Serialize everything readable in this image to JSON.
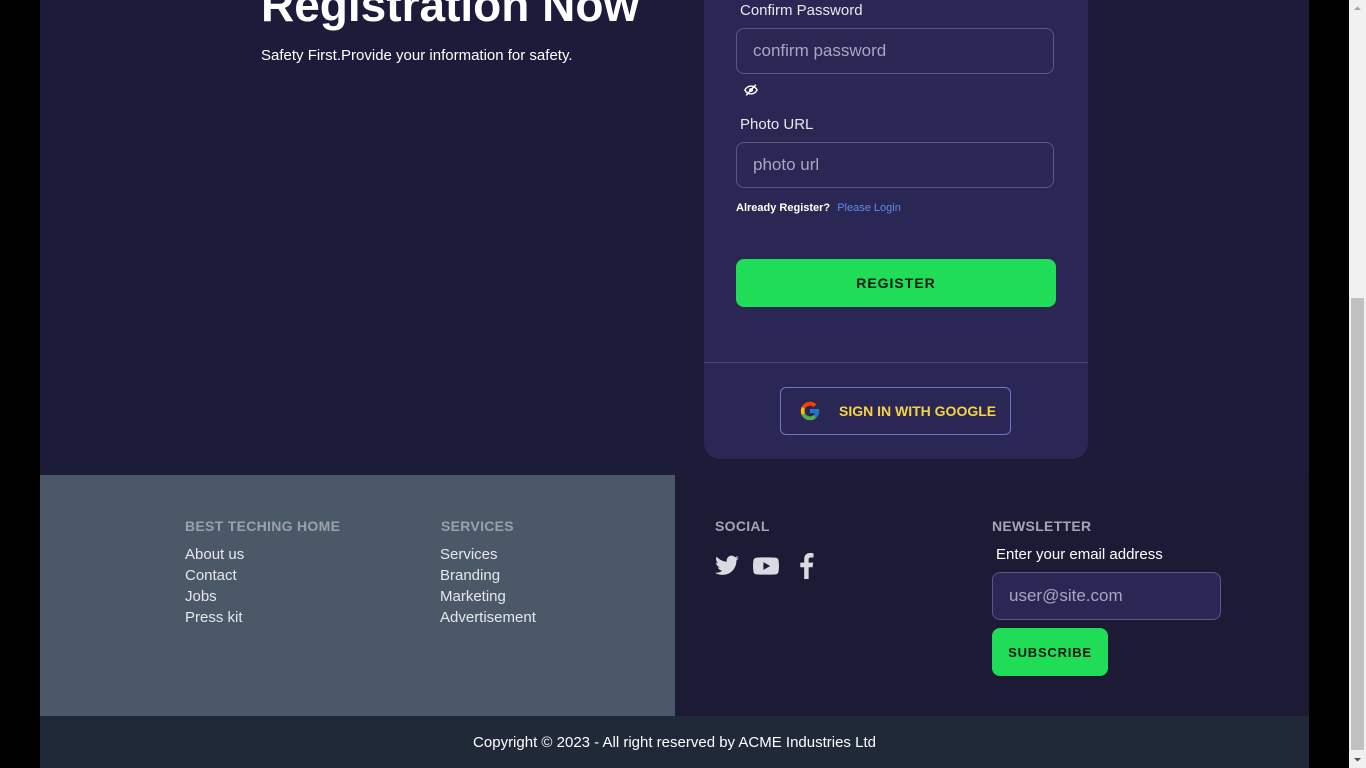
{
  "hero": {
    "title": "Registration Now",
    "subtitle": "Safety First.Provide your information for safety."
  },
  "form": {
    "confirm_password_label": "Confirm Password",
    "confirm_password_placeholder": "confirm password",
    "photo_url_label": "Photo URL",
    "photo_url_placeholder": "photo url",
    "already_text": "Already Register?",
    "login_link": "Please Login",
    "register_button": "REGISTER",
    "google_button": "SIGN IN WITH GOOGLE"
  },
  "footer": {
    "col1": {
      "heading": "BEST TECHING HOME",
      "links": [
        "About us",
        "Contact",
        "Jobs",
        "Press kit"
      ]
    },
    "col2": {
      "heading": "SERVICES",
      "links": [
        "Services",
        "Branding",
        "Marketing",
        "Advertisement"
      ]
    },
    "social": {
      "heading": "SOCIAL",
      "icons": [
        "twitter-icon",
        "youtube-icon",
        "facebook-icon"
      ]
    },
    "newsletter": {
      "heading": "NEWSLETTER",
      "label": "Enter your email address",
      "placeholder": "user@site.com",
      "button": "SUBSCRIBE"
    },
    "copyright": "Copyright © 2023 - All right reserved by ACME Industries Ltd"
  },
  "colors": {
    "page_bg": "#1d1b3a",
    "card_bg": "#2a2754",
    "accent_green": "#1fdd57",
    "link_blue": "#5b8def",
    "google_text": "#f5d547",
    "footer_left_bg": "#4a5868",
    "bottom_bar_bg": "#1f2937"
  }
}
